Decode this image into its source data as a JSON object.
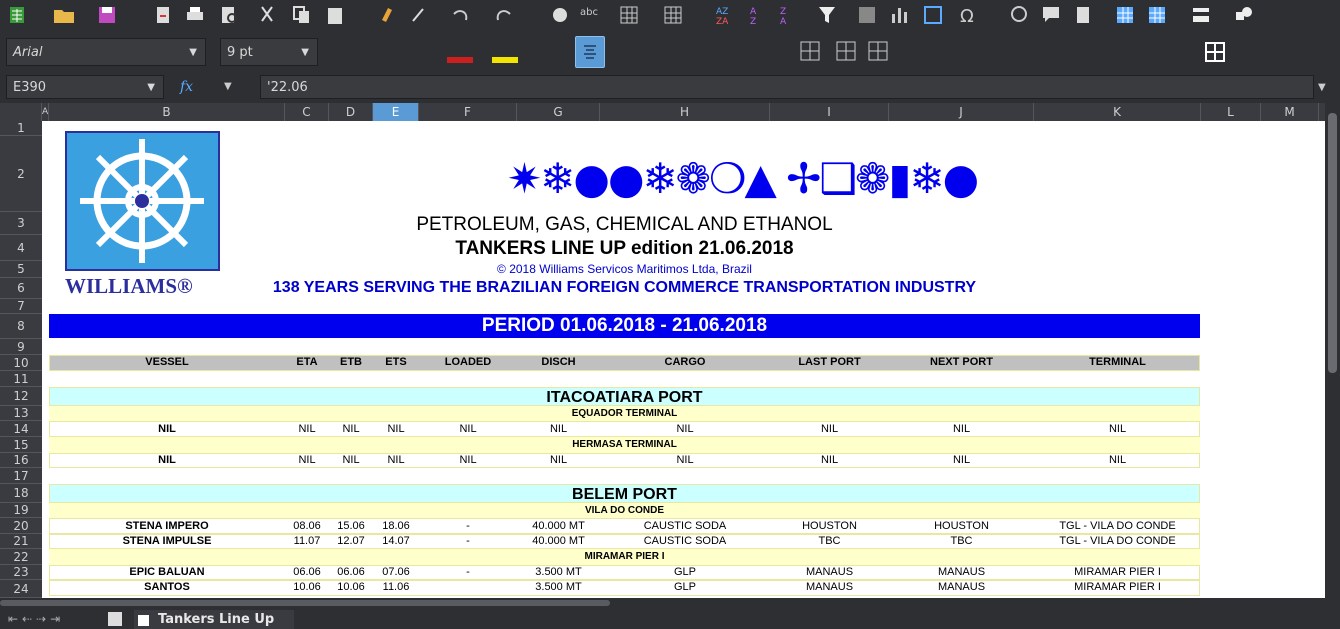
{
  "toolbar": {
    "icons": [
      "new-spreadsheet-icon",
      "open-folder-icon",
      "save-icon",
      "export-pdf-icon",
      "print-icon",
      "print-preview-icon",
      "cut-icon",
      "copy-icon",
      "paste-icon",
      "clone-formatting-icon",
      "clear-formatting-icon",
      "undo-icon",
      "redo-icon",
      "find-replace-icon",
      "spelling-icon",
      "row-icon",
      "column-icon",
      "sort-icon",
      "sort-ascending-icon",
      "sort-descending-icon",
      "autofilter-icon",
      "image-icon",
      "chart-icon",
      "pivot-table-icon",
      "special-character-icon",
      "hyperlink-icon",
      "comment-icon",
      "header-footer-icon",
      "define-print-area-icon",
      "freeze-rows-icon",
      "split-window-icon",
      "show-draw-functions-icon"
    ],
    "font_name": "Arial",
    "font_size": "9 pt"
  },
  "formula_bar": {
    "cell_ref": "E390",
    "fx_label": "fx",
    "content": "'22.06"
  },
  "columns": [
    "A",
    "B",
    "C",
    "D",
    "E",
    "F",
    "G",
    "H",
    "I",
    "J",
    "K",
    "L",
    "M"
  ],
  "rows": [
    "1",
    "2",
    "3",
    "4",
    "5",
    "6",
    "7",
    "8",
    "9",
    "10",
    "11",
    "12",
    "13",
    "14",
    "15",
    "16",
    "17",
    "18",
    "19",
    "20",
    "21",
    "22",
    "23",
    "24"
  ],
  "logo_text": "WILLIAMS®",
  "dingbats": "✷❄●●❄❁❍▲ ✢❑❁▮❄●",
  "title1": "PETROLEUM, GAS, CHEMICAL AND ETHANOL",
  "title2": "TANKERS LINE UP edition 21.06.2018",
  "copyright": "© 2018 Williams Servicos Maritimos Ltda, Brazil",
  "slogan": "138 YEARS SERVING THE BRAZILIAN FOREIGN COMMERCE TRANSPORTATION INDUSTRY",
  "period": "PERIOD 01.06.2018 - 21.06.2018",
  "table_headers": [
    "VESSEL",
    "ETA",
    "ETB",
    "ETS",
    "LOADED",
    "DISCH",
    "CARGO",
    "LAST PORT",
    "NEXT PORT",
    "TERMINAL"
  ],
  "port1": "ITACOATIARA PORT",
  "term1": "EQUADOR TERMINAL",
  "row14": [
    "NIL",
    "NIL",
    "NIL",
    "NIL",
    "NIL",
    "NIL",
    "NIL",
    "NIL",
    "NIL",
    "NIL"
  ],
  "term2": "HERMASA TERMINAL",
  "row16": [
    "NIL",
    "NIL",
    "NIL",
    "NIL",
    "NIL",
    "NIL",
    "NIL",
    "NIL",
    "NIL",
    "NIL"
  ],
  "port2": "BELEM PORT",
  "term3": "VILA DO CONDE",
  "row20": [
    "STENA IMPERO",
    "08.06",
    "15.06",
    "18.06",
    "-",
    "40.000 MT",
    "CAUSTIC SODA",
    "HOUSTON",
    "HOUSTON",
    "TGL - VILA DO CONDE"
  ],
  "row21": [
    "STENA IMPULSE",
    "11.07",
    "12.07",
    "14.07",
    "-",
    "40.000 MT",
    "CAUSTIC SODA",
    "TBC",
    "TBC",
    "TGL - VILA DO CONDE"
  ],
  "term4": "MIRAMAR PIER I",
  "row23": [
    "EPIC BALUAN",
    "06.06",
    "06.06",
    "07.06",
    "-",
    "3.500 MT",
    "GLP",
    "MANAUS",
    "MANAUS",
    "MIRAMAR PIER I"
  ],
  "row24": [
    "SANTOS",
    "10.06",
    "10.06",
    "11.06",
    "",
    "3.500 MT",
    "GLP",
    "MANAUS",
    "MANAUS",
    "MIRAMAR PIER I"
  ],
  "sheet_tab": "Tankers Line Up"
}
